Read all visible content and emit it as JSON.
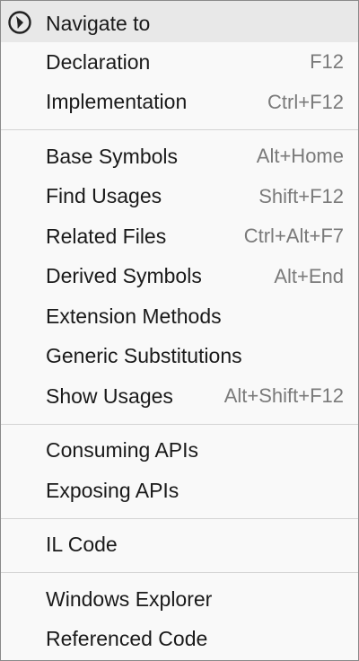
{
  "menu": {
    "header": {
      "title": "Navigate to",
      "icon": "navigate-compass-icon"
    },
    "groups": [
      {
        "items": [
          {
            "label": "Declaration",
            "shortcut": "F12"
          },
          {
            "label": "Implementation",
            "shortcut": "Ctrl+F12"
          }
        ]
      },
      {
        "items": [
          {
            "label": "Base Symbols",
            "shortcut": "Alt+Home"
          },
          {
            "label": "Find Usages",
            "shortcut": "Shift+F12"
          },
          {
            "label": "Related Files",
            "shortcut": "Ctrl+Alt+F7"
          },
          {
            "label": "Derived Symbols",
            "shortcut": "Alt+End"
          },
          {
            "label": "Extension Methods",
            "shortcut": ""
          },
          {
            "label": "Generic Substitutions",
            "shortcut": ""
          },
          {
            "label": "Show Usages",
            "shortcut": "Alt+Shift+F12"
          }
        ]
      },
      {
        "items": [
          {
            "label": "Consuming APIs",
            "shortcut": ""
          },
          {
            "label": "Exposing APIs",
            "shortcut": ""
          }
        ]
      },
      {
        "items": [
          {
            "label": "IL Code",
            "shortcut": ""
          }
        ]
      },
      {
        "items": [
          {
            "label": "Windows Explorer",
            "shortcut": ""
          },
          {
            "label": "Referenced Code",
            "shortcut": ""
          }
        ]
      }
    ]
  }
}
